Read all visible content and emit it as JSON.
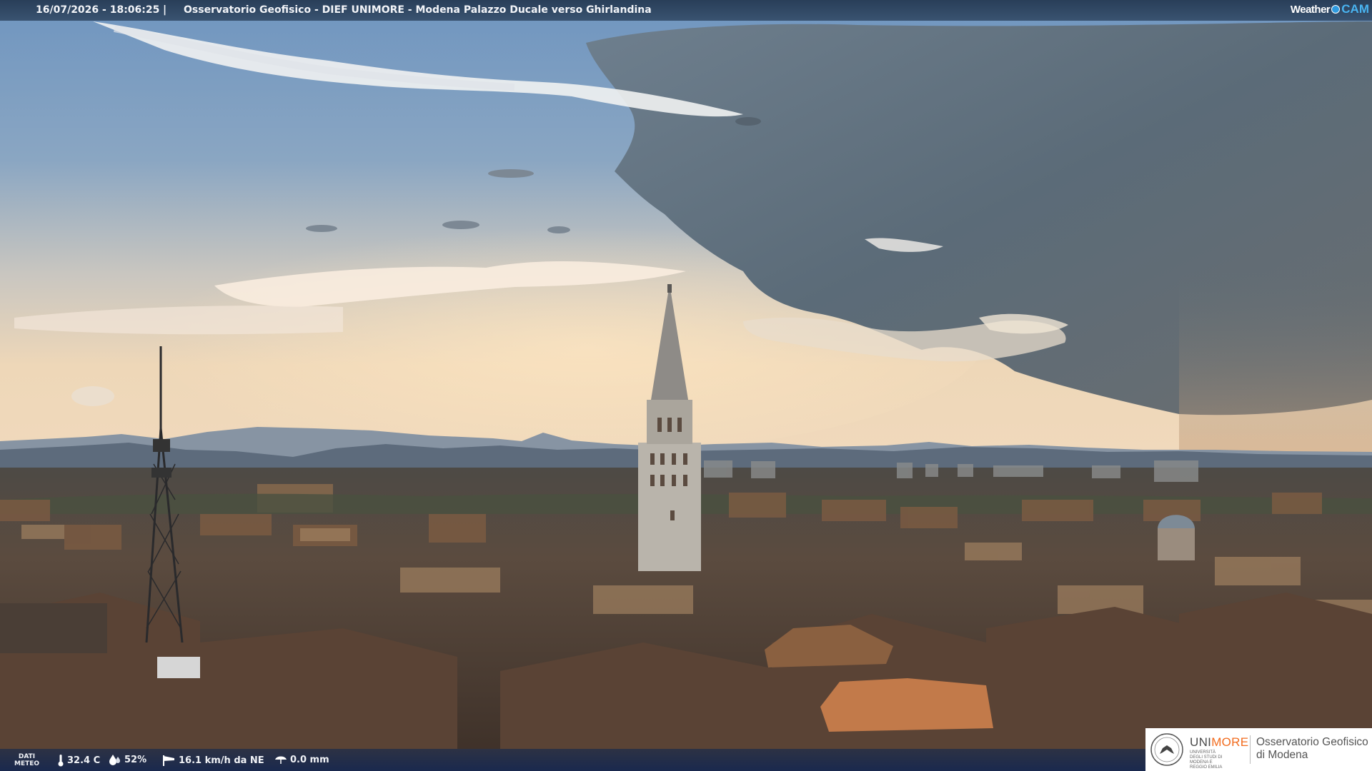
{
  "header": {
    "timestamp": "16/07/2026 - 18:06:25",
    "separator": "|",
    "title": "Osservatorio Geofisico - DIEF UNIMORE - Modena Palazzo Ducale verso Ghirlandina"
  },
  "brand": {
    "weather": "Weather",
    "cam": "CAM"
  },
  "weather": {
    "label_line1": "DATI",
    "label_line2": "METEO",
    "temperature": "32.4 C",
    "humidity": "52%",
    "wind": "16.1 km/h da NE",
    "rain": "0.0 mm"
  },
  "logo": {
    "uni": "UNI",
    "more": "MORE",
    "subtitle": "UNIVERSITÀ DEGLI STUDI DI MODENA E REGGIO EMILIA",
    "observatory_line1": "Osservatorio Geofisico",
    "observatory_line2": "di Modena"
  },
  "colors": {
    "sky_blue": "#7f9fbf",
    "storm_gray": "#5e6c78",
    "horizon_glow": "#e8d2b4",
    "roof_brown": "#6a4e3c",
    "unimore_orange": "#f26b1d"
  }
}
